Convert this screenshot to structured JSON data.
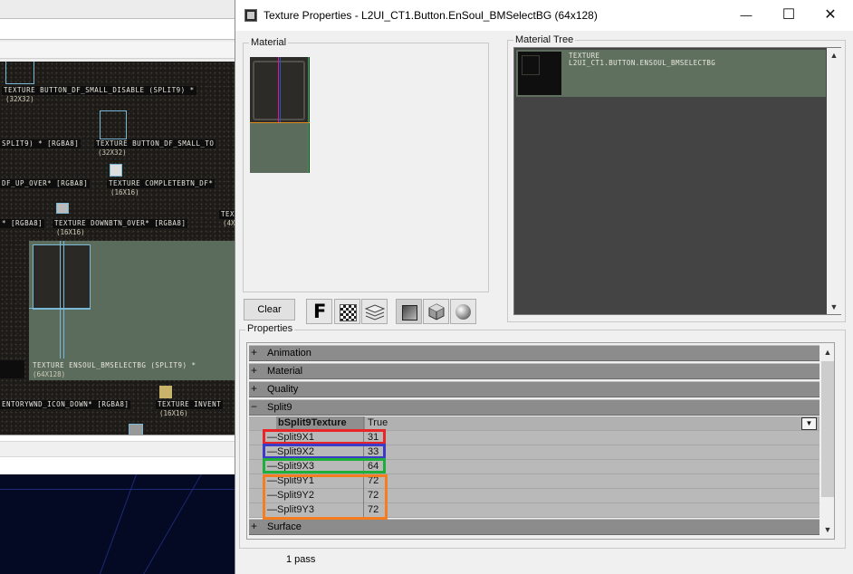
{
  "browser": {
    "tiles": [
      {
        "label": "TEXTURE BUTTON_DF_SMALL_DISABLE (SPLIT9) *",
        "size": "(32X32)"
      },
      {
        "label": "SPLIT9) * [RGBA8]"
      },
      {
        "label": "TEXTURE BUTTON_DF_SMALL_TO",
        "size": "(32X32)"
      },
      {
        "label": "DF_UP_OVER* [RGBA8]"
      },
      {
        "label": "TEXTURE COMPLETEBTN_DF*",
        "size": "(16X16)"
      },
      {
        "label": "* [RGBA8]"
      },
      {
        "label": "TEXTURE DOWNBTN_OVER* [RGBA8]",
        "size": "(16X16)"
      },
      {
        "label": "TEXTURE ENSOUL_BMSELECTBG (SPLIT9) *",
        "size": "(64X128)"
      },
      {
        "label": "ENTORYWND_ICON_DOWN* [RGBA8]"
      },
      {
        "label": "TEXTURE INVENT",
        "size": "(16X16)"
      },
      {
        "label": "TEXTU",
        "size": "(4X"
      }
    ]
  },
  "dialog": {
    "title": "Texture Properties - L2UI_CT1.Button.EnSoul_BMSelectBG (64x128)",
    "window_buttons": {
      "minimize": "—",
      "maximize": "☐",
      "close": "✕"
    },
    "material_group": "Material",
    "tree_group": "Material Tree",
    "tree_item": {
      "line1": "TEXTURE",
      "line2": "L2UI_CT1.BUTTON.ENSOUL_BMSELECTBG"
    },
    "clear_label": "Clear",
    "toolbar_icons": [
      "font-icon",
      "checker-icon",
      "layers-icon",
      "flat-shade-icon",
      "cube-icon",
      "sphere-icon"
    ],
    "properties_group": "Properties",
    "categories": {
      "animation": "Animation",
      "material": "Material",
      "quality": "Quality",
      "split9": "Split9",
      "surface": "Surface"
    },
    "split9_props": [
      {
        "name": "bSplit9Texture",
        "value": "True"
      },
      {
        "name": "Split9X1",
        "value": "31"
      },
      {
        "name": "Split9X2",
        "value": "33"
      },
      {
        "name": "Split9X3",
        "value": "64"
      },
      {
        "name": "Split9Y1",
        "value": "72"
      },
      {
        "name": "Split9Y2",
        "value": "72"
      },
      {
        "name": "Split9Y3",
        "value": "72"
      }
    ],
    "highlight_colors": {
      "x1": "#e8262a",
      "x2": "#3b3bc8",
      "x3": "#1fae3a",
      "y": "#f57c1f"
    },
    "status_text": "1 pass"
  }
}
